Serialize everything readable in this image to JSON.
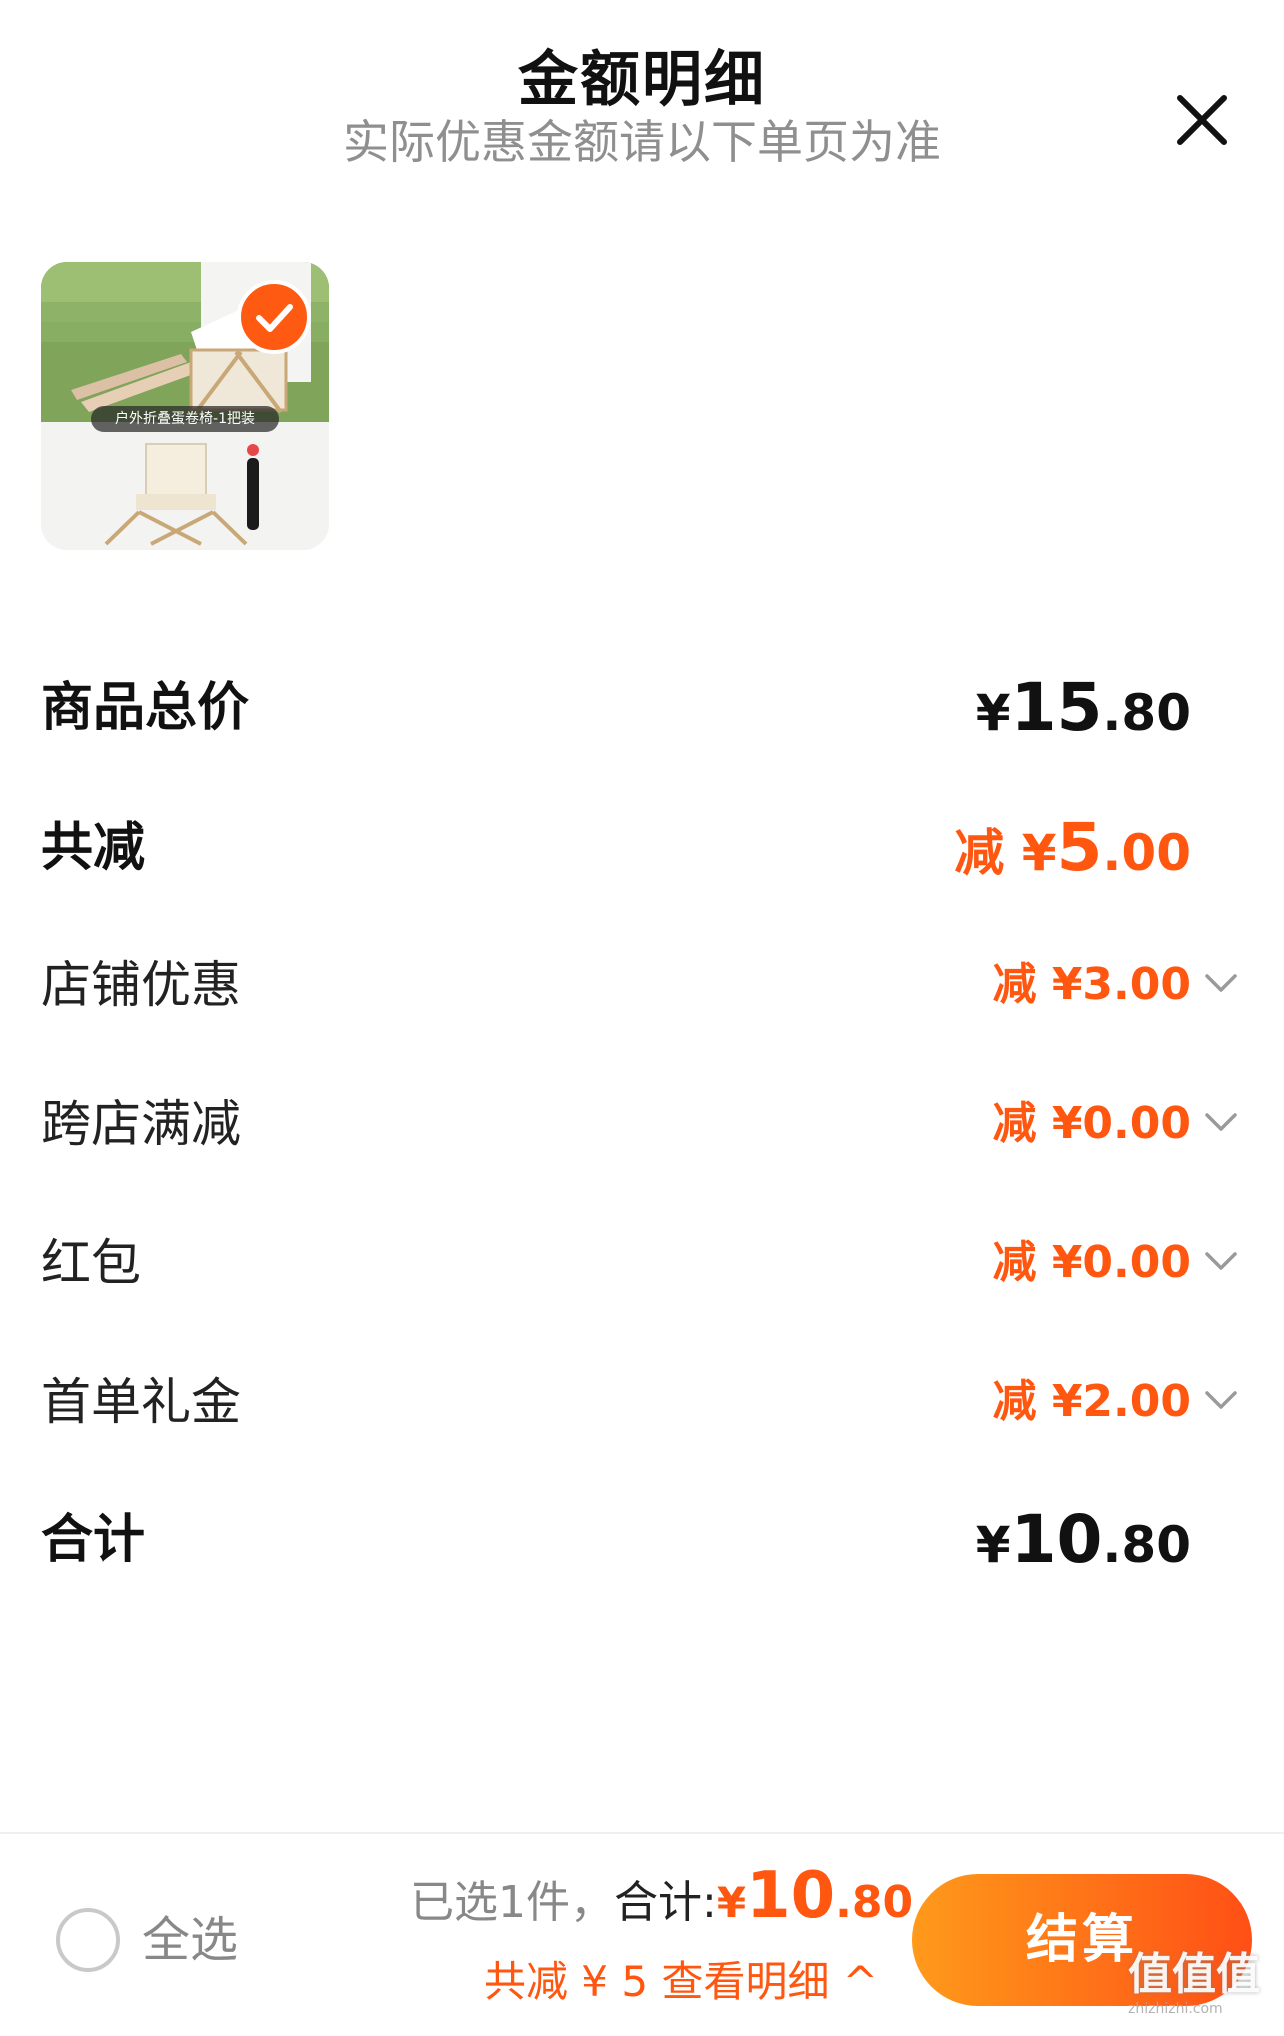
{
  "header": {
    "title": "金额明细",
    "subtitle": "实际优惠金额请以下单页为准"
  },
  "product": {
    "caption": "户外折叠蛋卷椅-1把装",
    "selected": true
  },
  "breakdown": {
    "subtotal": {
      "label": "商品总价",
      "symbol": "¥",
      "int": "15",
      "dec": ".80"
    },
    "total_discount": {
      "label": "共减",
      "prefix": "减 ¥",
      "int": "5",
      "dec": ".00"
    },
    "discounts": [
      {
        "label": "店铺优惠",
        "amount": "减 ¥3.00"
      },
      {
        "label": "跨店满减",
        "amount": "减 ¥0.00"
      },
      {
        "label": "红包",
        "amount": "减 ¥0.00"
      },
      {
        "label": "首单礼金",
        "amount": "减 ¥2.00"
      }
    ],
    "total": {
      "label": "合计",
      "symbol": "¥",
      "int": "10",
      "dec": ".80"
    }
  },
  "footer": {
    "select_all": "全选",
    "selected_text": "已选1件，",
    "total_label": "合计:",
    "price_symbol": "¥",
    "price_int": "10",
    "price_dec": ".80",
    "detail_link": "共减 ¥ 5 查看明细 ^",
    "checkout": "结算"
  },
  "watermark": {
    "main": "值值值",
    "sub": "zhizhizhi.com"
  },
  "colors": {
    "accent": "#ff5610",
    "checkout_start": "#ff9a1a",
    "checkout_end": "#ff4f16"
  }
}
